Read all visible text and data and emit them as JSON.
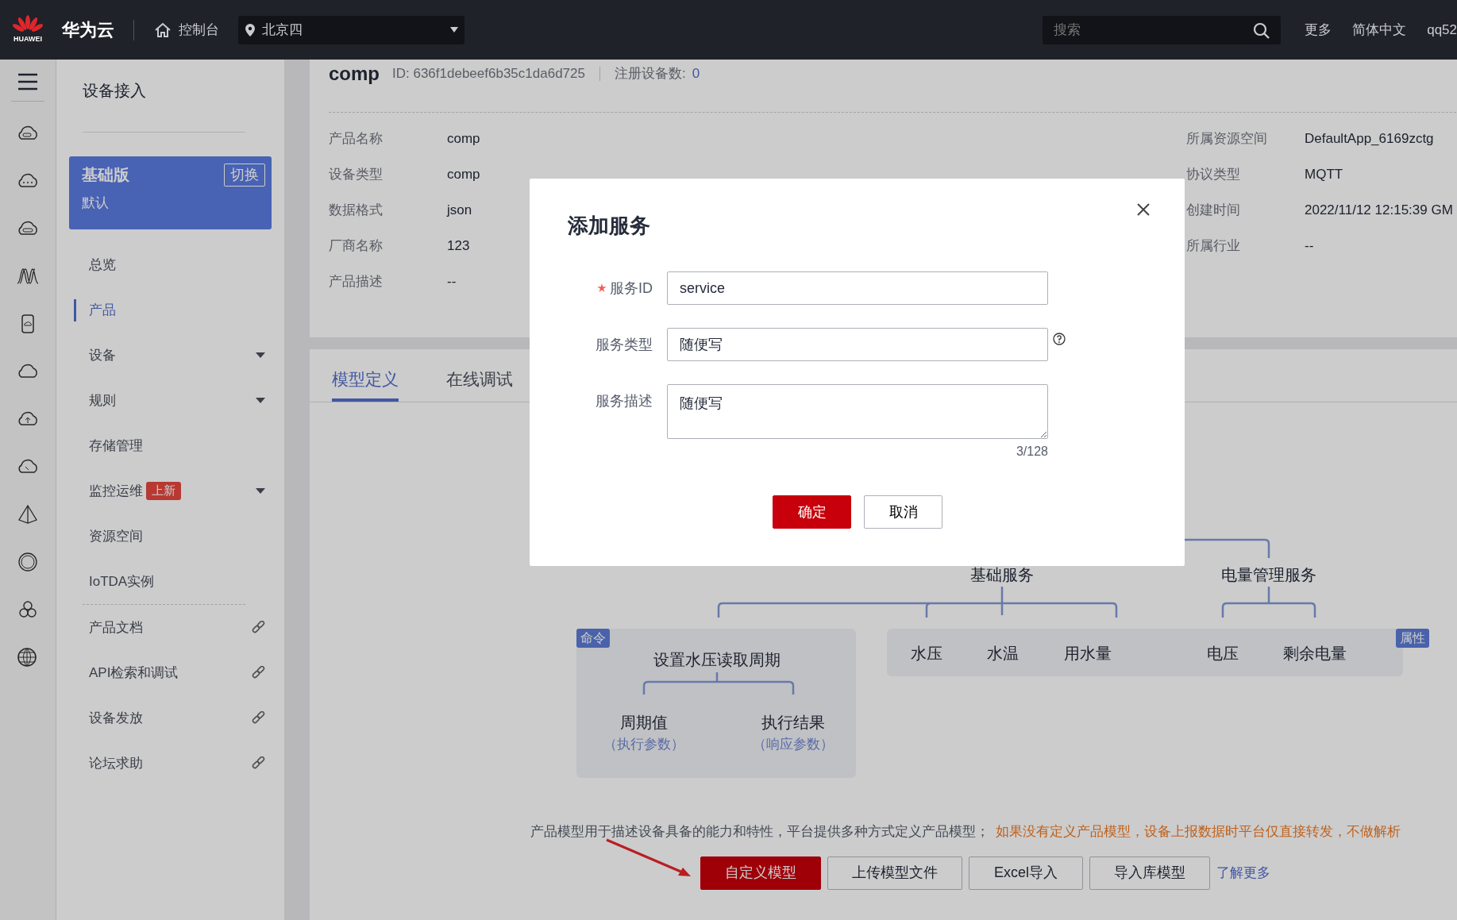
{
  "topbar": {
    "logo_text": "HUAWEI",
    "brand": "华为云",
    "console": "控制台",
    "region": "北京四",
    "search_placeholder": "搜索",
    "links": [
      "更多",
      "简体中文",
      "qq52"
    ]
  },
  "sidebar": {
    "title": "设备接入",
    "edition": {
      "name": "基础版",
      "subtitle": "默认",
      "switch": "切换"
    },
    "items": [
      {
        "label": "总览",
        "kind": "plain",
        "selected": false
      },
      {
        "label": "产品",
        "kind": "plain",
        "selected": true
      },
      {
        "label": "设备",
        "kind": "dropdown",
        "selected": false
      },
      {
        "label": "规则",
        "kind": "dropdown",
        "selected": false
      },
      {
        "label": "存储管理",
        "kind": "plain",
        "selected": false
      },
      {
        "label": "监控运维",
        "kind": "dropdown",
        "selected": false,
        "badge": "上新"
      },
      {
        "label": "资源空间",
        "kind": "plain",
        "selected": false
      },
      {
        "label": "IoTDA实例",
        "kind": "plain",
        "selected": false
      },
      {
        "label": "产品文档",
        "kind": "link",
        "selected": false
      },
      {
        "label": "API检索和调试",
        "kind": "link",
        "selected": false
      },
      {
        "label": "设备发放",
        "kind": "link",
        "selected": false
      },
      {
        "label": "论坛求助",
        "kind": "link",
        "selected": false
      }
    ]
  },
  "product": {
    "name": "comp",
    "id": "ID: 636f1debeef6b35c1da6d725",
    "device_count_label": "注册设备数:",
    "device_count": "0",
    "details_left": [
      {
        "label": "产品名称",
        "value": "comp"
      },
      {
        "label": "设备类型",
        "value": "comp"
      },
      {
        "label": "数据格式",
        "value": "json"
      },
      {
        "label": "厂商名称",
        "value": "123"
      },
      {
        "label": "产品描述",
        "value": "--"
      }
    ],
    "details_right": [
      {
        "label": "所属资源空间",
        "value": "DefaultApp_6169zctg"
      },
      {
        "label": "协议类型",
        "value": "MQTT"
      },
      {
        "label": "创建时间",
        "value": "2022/11/12 12:15:39 GM"
      },
      {
        "label": "所属行业",
        "value": "--"
      }
    ]
  },
  "tabs": [
    {
      "label": "模型定义",
      "selected": true
    },
    {
      "label": "在线调试",
      "selected": false
    }
  ],
  "model_diagram": {
    "services": [
      {
        "label": "基础服务"
      },
      {
        "label": "电量管理服务"
      }
    ],
    "command": {
      "badge": "命令",
      "name": "设置水压读取周期",
      "params": [
        {
          "label": "周期值",
          "note": "（执行参数）"
        },
        {
          "label": "执行结果",
          "note": "（响应参数）"
        }
      ]
    },
    "properties": {
      "badge": "属性",
      "items": [
        "水压",
        "水温",
        "用水量",
        "电压",
        "剩余电量"
      ]
    }
  },
  "description": {
    "text": "产品模型用于描述设备具备的能力和特性，平台提供多种方式定义产品模型；",
    "warning": "如果没有定义产品模型，设备上报数据时平台仅直接转发，不做解析"
  },
  "actions": [
    {
      "label": "自定义模型",
      "kind": "primary"
    },
    {
      "label": "上传模型文件",
      "kind": "default"
    },
    {
      "label": "Excel导入",
      "kind": "default"
    },
    {
      "label": "导入库模型",
      "kind": "default"
    }
  ],
  "learn_more": "了解更多",
  "modal": {
    "title": "添加服务",
    "fields": [
      {
        "label": "服务ID",
        "required": true,
        "kind": "input",
        "value": "service",
        "help": false
      },
      {
        "label": "服务类型",
        "required": false,
        "kind": "input",
        "value": "随便写",
        "help": true
      },
      {
        "label": "服务描述",
        "required": false,
        "kind": "textarea",
        "value": "随便写",
        "help": false,
        "counter": "3/128"
      }
    ],
    "buttons": [
      {
        "label": "确定",
        "kind": "primary"
      },
      {
        "label": "取消",
        "kind": "default"
      }
    ]
  }
}
